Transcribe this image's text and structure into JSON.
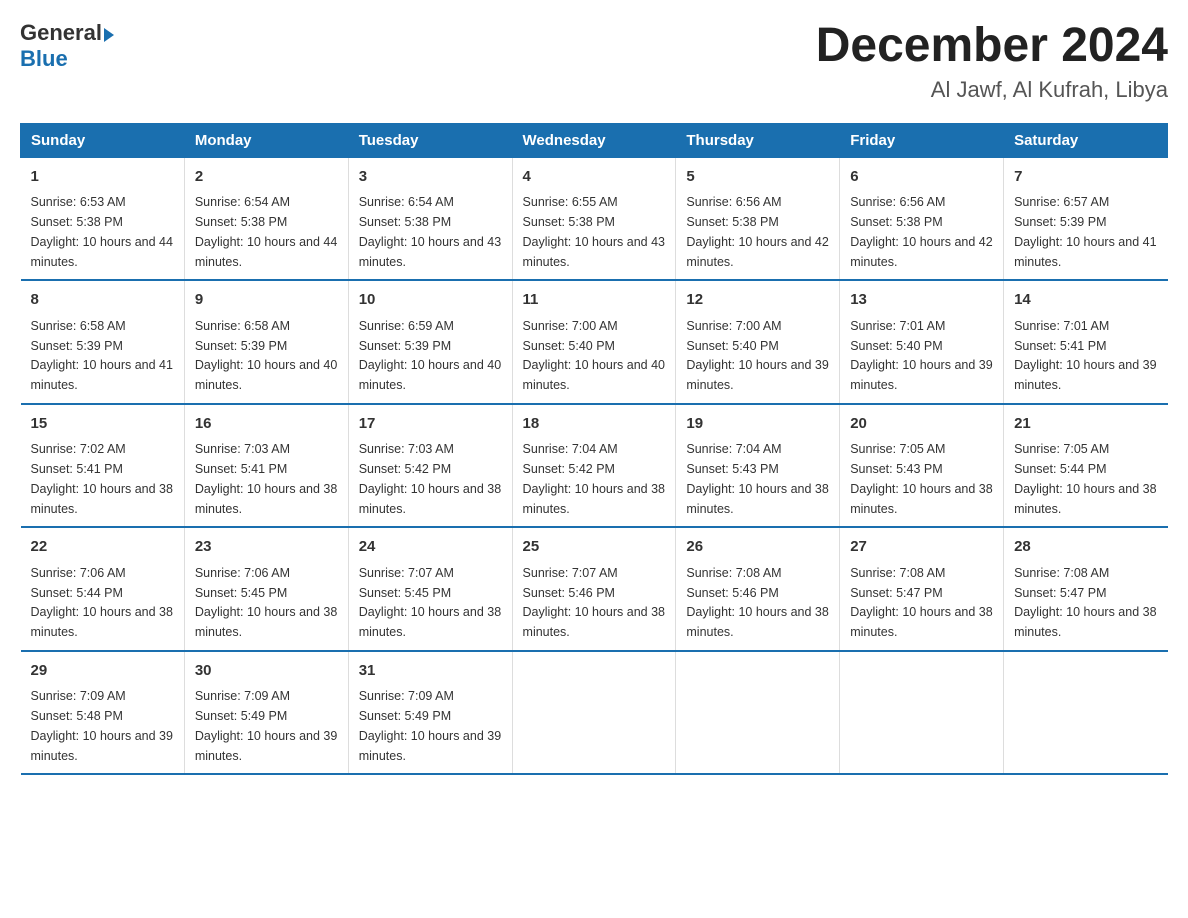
{
  "header": {
    "logo_general": "General",
    "logo_blue": "Blue",
    "month": "December 2024",
    "location": "Al Jawf, Al Kufrah, Libya"
  },
  "days_of_week": [
    "Sunday",
    "Monday",
    "Tuesday",
    "Wednesday",
    "Thursday",
    "Friday",
    "Saturday"
  ],
  "weeks": [
    [
      {
        "day": "1",
        "sunrise": "6:53 AM",
        "sunset": "5:38 PM",
        "daylight": "10 hours and 44 minutes."
      },
      {
        "day": "2",
        "sunrise": "6:54 AM",
        "sunset": "5:38 PM",
        "daylight": "10 hours and 44 minutes."
      },
      {
        "day": "3",
        "sunrise": "6:54 AM",
        "sunset": "5:38 PM",
        "daylight": "10 hours and 43 minutes."
      },
      {
        "day": "4",
        "sunrise": "6:55 AM",
        "sunset": "5:38 PM",
        "daylight": "10 hours and 43 minutes."
      },
      {
        "day": "5",
        "sunrise": "6:56 AM",
        "sunset": "5:38 PM",
        "daylight": "10 hours and 42 minutes."
      },
      {
        "day": "6",
        "sunrise": "6:56 AM",
        "sunset": "5:38 PM",
        "daylight": "10 hours and 42 minutes."
      },
      {
        "day": "7",
        "sunrise": "6:57 AM",
        "sunset": "5:39 PM",
        "daylight": "10 hours and 41 minutes."
      }
    ],
    [
      {
        "day": "8",
        "sunrise": "6:58 AM",
        "sunset": "5:39 PM",
        "daylight": "10 hours and 41 minutes."
      },
      {
        "day": "9",
        "sunrise": "6:58 AM",
        "sunset": "5:39 PM",
        "daylight": "10 hours and 40 minutes."
      },
      {
        "day": "10",
        "sunrise": "6:59 AM",
        "sunset": "5:39 PM",
        "daylight": "10 hours and 40 minutes."
      },
      {
        "day": "11",
        "sunrise": "7:00 AM",
        "sunset": "5:40 PM",
        "daylight": "10 hours and 40 minutes."
      },
      {
        "day": "12",
        "sunrise": "7:00 AM",
        "sunset": "5:40 PM",
        "daylight": "10 hours and 39 minutes."
      },
      {
        "day": "13",
        "sunrise": "7:01 AM",
        "sunset": "5:40 PM",
        "daylight": "10 hours and 39 minutes."
      },
      {
        "day": "14",
        "sunrise": "7:01 AM",
        "sunset": "5:41 PM",
        "daylight": "10 hours and 39 minutes."
      }
    ],
    [
      {
        "day": "15",
        "sunrise": "7:02 AM",
        "sunset": "5:41 PM",
        "daylight": "10 hours and 38 minutes."
      },
      {
        "day": "16",
        "sunrise": "7:03 AM",
        "sunset": "5:41 PM",
        "daylight": "10 hours and 38 minutes."
      },
      {
        "day": "17",
        "sunrise": "7:03 AM",
        "sunset": "5:42 PM",
        "daylight": "10 hours and 38 minutes."
      },
      {
        "day": "18",
        "sunrise": "7:04 AM",
        "sunset": "5:42 PM",
        "daylight": "10 hours and 38 minutes."
      },
      {
        "day": "19",
        "sunrise": "7:04 AM",
        "sunset": "5:43 PM",
        "daylight": "10 hours and 38 minutes."
      },
      {
        "day": "20",
        "sunrise": "7:05 AM",
        "sunset": "5:43 PM",
        "daylight": "10 hours and 38 minutes."
      },
      {
        "day": "21",
        "sunrise": "7:05 AM",
        "sunset": "5:44 PM",
        "daylight": "10 hours and 38 minutes."
      }
    ],
    [
      {
        "day": "22",
        "sunrise": "7:06 AM",
        "sunset": "5:44 PM",
        "daylight": "10 hours and 38 minutes."
      },
      {
        "day": "23",
        "sunrise": "7:06 AM",
        "sunset": "5:45 PM",
        "daylight": "10 hours and 38 minutes."
      },
      {
        "day": "24",
        "sunrise": "7:07 AM",
        "sunset": "5:45 PM",
        "daylight": "10 hours and 38 minutes."
      },
      {
        "day": "25",
        "sunrise": "7:07 AM",
        "sunset": "5:46 PM",
        "daylight": "10 hours and 38 minutes."
      },
      {
        "day": "26",
        "sunrise": "7:08 AM",
        "sunset": "5:46 PM",
        "daylight": "10 hours and 38 minutes."
      },
      {
        "day": "27",
        "sunrise": "7:08 AM",
        "sunset": "5:47 PM",
        "daylight": "10 hours and 38 minutes."
      },
      {
        "day": "28",
        "sunrise": "7:08 AM",
        "sunset": "5:47 PM",
        "daylight": "10 hours and 38 minutes."
      }
    ],
    [
      {
        "day": "29",
        "sunrise": "7:09 AM",
        "sunset": "5:48 PM",
        "daylight": "10 hours and 39 minutes."
      },
      {
        "day": "30",
        "sunrise": "7:09 AM",
        "sunset": "5:49 PM",
        "daylight": "10 hours and 39 minutes."
      },
      {
        "day": "31",
        "sunrise": "7:09 AM",
        "sunset": "5:49 PM",
        "daylight": "10 hours and 39 minutes."
      },
      null,
      null,
      null,
      null
    ]
  ]
}
